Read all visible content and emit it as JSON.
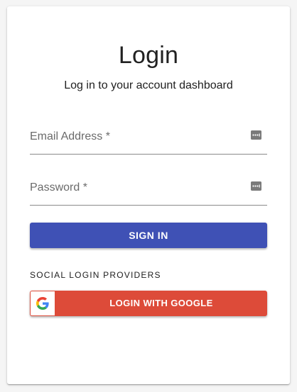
{
  "login": {
    "title": "Login",
    "subtitle": "Log in to your account dashboard"
  },
  "email": {
    "label": "Email Address *",
    "value": ""
  },
  "password": {
    "label": "Password *",
    "value": ""
  },
  "actions": {
    "sign_in_label": "SIGN IN"
  },
  "social": {
    "heading": "SOCIAL LOGIN PROVIDERS",
    "google_label": "LOGIN WITH GOOGLE"
  },
  "icons": {
    "password_manager": "password-key-icon",
    "google": "google-logo-icon"
  },
  "colors": {
    "primary": "#3f51b5",
    "google": "#dd4b39",
    "text": "#212121",
    "label": "#6b6b6b"
  }
}
